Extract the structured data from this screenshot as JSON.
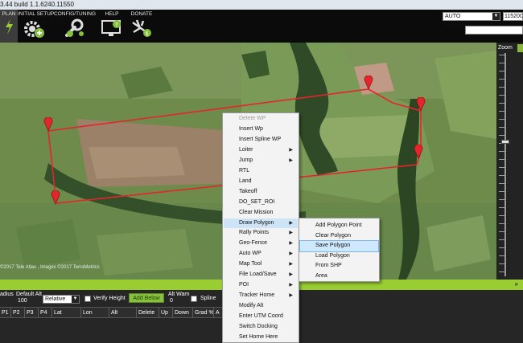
{
  "titlebar": {
    "text": "3.44 build 1.1.6240.11550"
  },
  "toolbar": {
    "items": [
      {
        "label": "PLAN",
        "icon": "flight-plan-icon"
      },
      {
        "label": "INITIAL SETUP",
        "icon": "setup-gear-icon"
      },
      {
        "label": "CONFIG/TUNING",
        "icon": "wrench-icon"
      },
      {
        "label": "HELP",
        "icon": "help-monitor-icon"
      },
      {
        "label": "DONATE",
        "icon": "donate-plane-icon"
      }
    ],
    "mode_value": "AUTO",
    "baud_value": "115200"
  },
  "map": {
    "copyright": "©2017 Tele Atlas , Images ©2017 TerraMetrics",
    "zoom_label": "Zoom",
    "accent_color": "#e4252b"
  },
  "bottom": {
    "radius_label": "adius",
    "default_alt_label": "Default Alt",
    "default_alt_value": "100",
    "altmode_value": "Relative",
    "verify_height_label": "Verify Height",
    "add_below_label": "Add Below",
    "alt_warn_label": "Alt Warn",
    "alt_warn_value": "0",
    "spline_label": "Spline",
    "columns": [
      "P1",
      "P2",
      "P3",
      "P4",
      "Lat",
      "Lon",
      "Alt",
      "Delete",
      "Up",
      "Down",
      "Grad %",
      "A"
    ]
  },
  "context_menu": {
    "items": [
      {
        "label": "Delete WP",
        "disabled": true,
        "submenu": false
      },
      {
        "label": "Insert Wp",
        "disabled": false,
        "submenu": false
      },
      {
        "label": "Insert Spline WP",
        "disabled": false,
        "submenu": false
      },
      {
        "label": "Loiter",
        "disabled": false,
        "submenu": true
      },
      {
        "label": "Jump",
        "disabled": false,
        "submenu": true
      },
      {
        "label": "RTL",
        "disabled": false,
        "submenu": false
      },
      {
        "label": "Land",
        "disabled": false,
        "submenu": false
      },
      {
        "label": "Takeoff",
        "disabled": false,
        "submenu": false
      },
      {
        "label": "DO_SET_ROI",
        "disabled": false,
        "submenu": false
      },
      {
        "label": "Clear Mission",
        "disabled": false,
        "submenu": false
      },
      {
        "label": "Draw Polygon",
        "disabled": false,
        "submenu": true,
        "active": true
      },
      {
        "label": "Rally Points",
        "disabled": false,
        "submenu": true
      },
      {
        "label": "Geo-Fence",
        "disabled": false,
        "submenu": true
      },
      {
        "label": "Auto WP",
        "disabled": false,
        "submenu": true
      },
      {
        "label": "Map Tool",
        "disabled": false,
        "submenu": true
      },
      {
        "label": "File Load/Save",
        "disabled": false,
        "submenu": true
      },
      {
        "label": "POI",
        "disabled": false,
        "submenu": true
      },
      {
        "label": "Tracker Home",
        "disabled": false,
        "submenu": true
      },
      {
        "label": "Modify Alt",
        "disabled": false,
        "submenu": false
      },
      {
        "label": "Enter UTM Coord",
        "disabled": false,
        "submenu": false
      },
      {
        "label": "Switch Docking",
        "disabled": false,
        "submenu": false
      },
      {
        "label": "Set Home Here",
        "disabled": false,
        "submenu": false
      }
    ]
  },
  "polygon_submenu": {
    "items": [
      {
        "label": "Add Polygon Point"
      },
      {
        "label": "Clear Polygon"
      },
      {
        "label": "Save Polygon",
        "highlight": true
      },
      {
        "label": "Load Polygon"
      },
      {
        "label": "From SHP"
      },
      {
        "label": "Area"
      }
    ]
  }
}
